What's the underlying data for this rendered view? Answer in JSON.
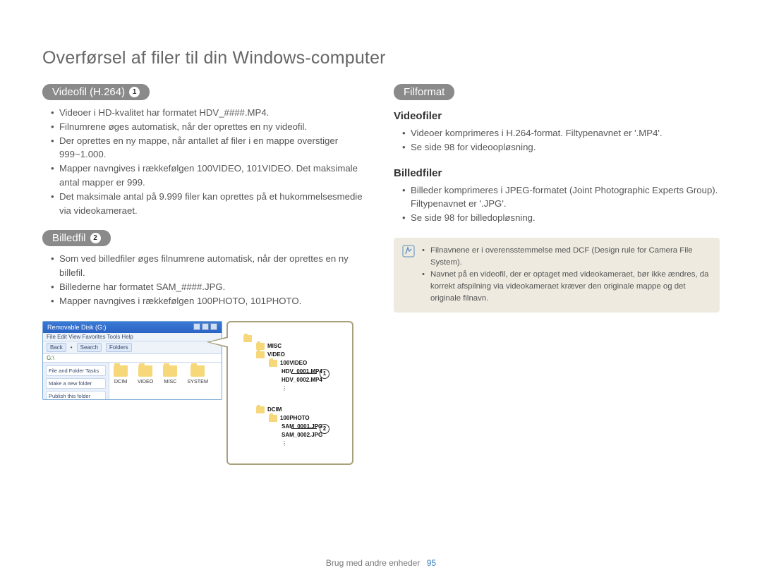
{
  "title": "Overførsel af filer til din Windows-computer",
  "left": {
    "videofil": {
      "label": "Videofil (H.264)",
      "num": "1",
      "items": [
        "Videoer i HD-kvalitet har formatet HDV_####.MP4.",
        "Filnumrene øges automatisk, når der oprettes en ny videofil.",
        "Der oprettes en ny mappe, når antallet af filer i en mappe overstiger 999~1.000.",
        "Mapper navngives i rækkefølgen 100VIDEO, 101VIDEO. Det maksimale antal mapper er 999.",
        "Det maksimale antal på 9.999 filer kan oprettes på et hukommelsesmedie via videokameraet."
      ]
    },
    "billedfil": {
      "label": "Billedfil",
      "num": "2",
      "items": [
        "Som ved billedfiler øges filnumrene automatisk, når der oprettes en ny billefil.",
        "Billederne har formatet SAM_####.JPG.",
        "Mapper navngives i rækkefølgen 100PHOTO, 101PHOTO."
      ]
    }
  },
  "right": {
    "filformat": {
      "label": "Filformat"
    },
    "videofiler": {
      "label": "Videofiler",
      "items": [
        "Videoer komprimeres i H.264-format. Filtypenavnet er '.MP4'.",
        "Se side 98 for videoopløsning."
      ]
    },
    "billedfiler": {
      "label": "Billedfiler",
      "items": [
        "Billeder komprimeres i JPEG-formatet (Joint Photographic Experts Group). Filtypenavnet er '.JPG'.",
        "Se side 98 for billedopløsning."
      ]
    },
    "note": {
      "items": [
        "Filnavnene er i overensstemmelse med DCF (Design rule for Camera File System).",
        "Navnet på en videofil, der er optaget med videokameraet, bør ikke ændres, da korrekt afspilning via videokameraet kræver den originale mappe og det originale filnavn."
      ]
    }
  },
  "explorer": {
    "title": "Removable Disk (G:)",
    "menu": "File  Edit  View  Favorites  Tools  Help",
    "toolbar": {
      "back": "Back",
      "search": "Search",
      "folders": "Folders"
    },
    "address": "G:\\",
    "side": {
      "box1": "File and Folder Tasks",
      "box2a": "Make a new folder",
      "box2b": "Publish this folder"
    },
    "folders": [
      "DCIM",
      "VIDEO",
      "MISC",
      "SYSTEM"
    ]
  },
  "tree": {
    "root": "",
    "misc": "MISC",
    "video": "VIDEO",
    "v_folder": "100VIDEO",
    "v_f1": "HDV_0001.MP4",
    "v_f2": "HDV_0002.MP4",
    "dcim": "DCIM",
    "p_folder": "100PHOTO",
    "p_f1": "SAM_0001.JPG",
    "p_f2": "SAM_0002.JPG",
    "call1": "1",
    "call2": "2"
  },
  "footer": {
    "text": "Brug med andre enheder",
    "page": "95"
  }
}
